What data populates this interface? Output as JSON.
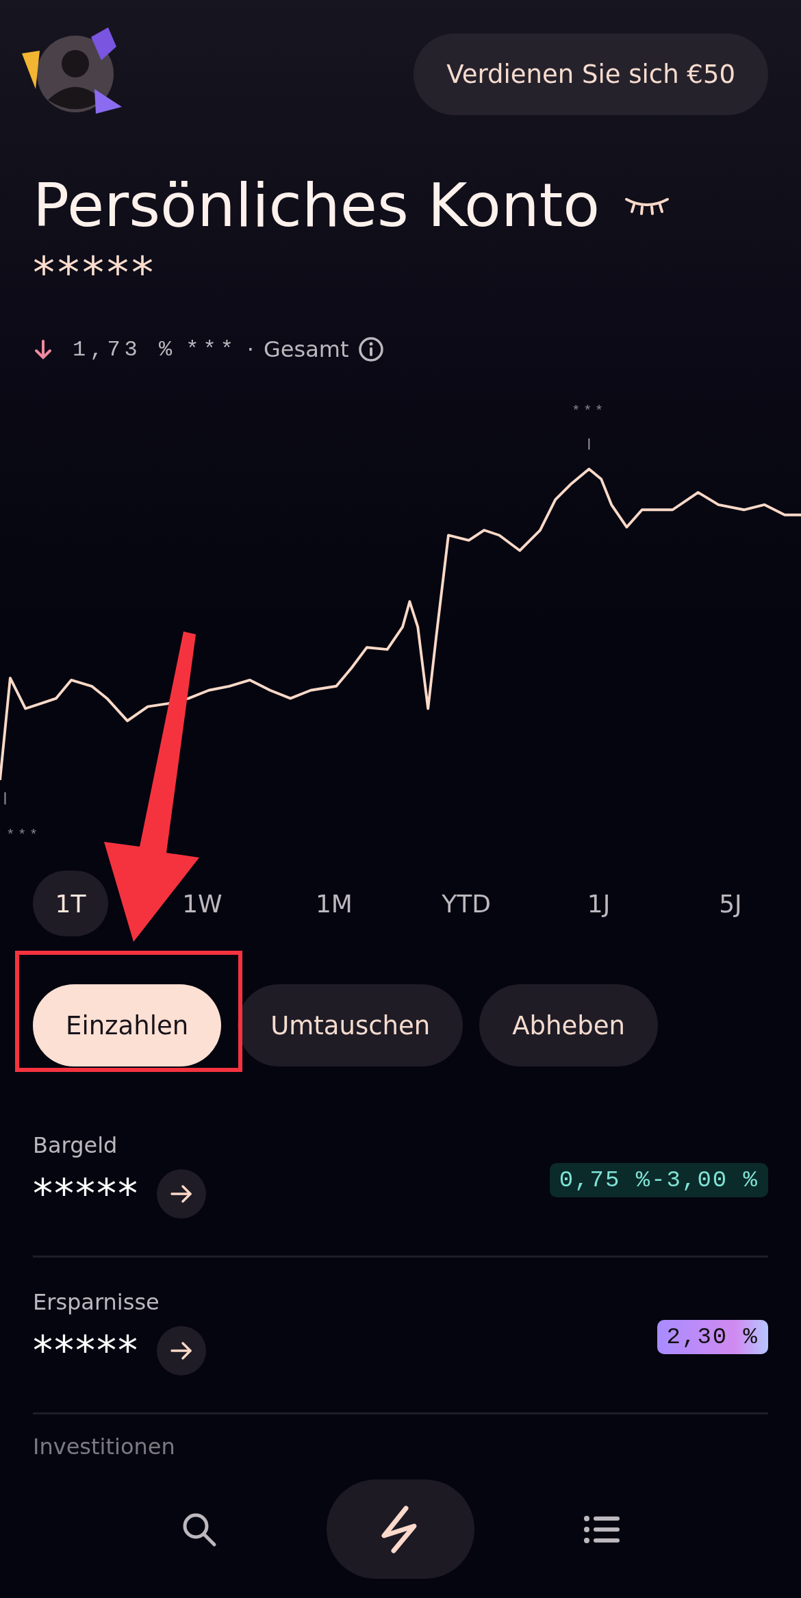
{
  "header": {
    "promo_button": "Verdienen Sie sich €50"
  },
  "account": {
    "title": "Persönliches Konto",
    "balance": "*****",
    "change": {
      "falling": true,
      "percent": "1,73 %",
      "amount": "***",
      "separator": "·",
      "period": "Gesamt"
    }
  },
  "chart": {
    "high_label": "***",
    "low_label": "***"
  },
  "periods": [
    {
      "label": "1T",
      "selected": true
    },
    {
      "label": "1W",
      "selected": false
    },
    {
      "label": "1M",
      "selected": false
    },
    {
      "label": "YTD",
      "selected": false
    },
    {
      "label": "1J",
      "selected": false
    },
    {
      "label": "5J",
      "selected": false
    }
  ],
  "actions": [
    {
      "label": "Einzahlen",
      "kind": "primary"
    },
    {
      "label": "Umtauschen",
      "kind": "secondary"
    },
    {
      "label": "Abheben",
      "kind": "secondary"
    }
  ],
  "accounts": [
    {
      "name": "Bargeld",
      "balance": "*****",
      "rate": "0,75 %-3,00 %",
      "kind": "teal"
    },
    {
      "name": "Ersparnisse",
      "balance": "*****",
      "rate": "2,30 %",
      "kind": "gradient"
    },
    {
      "name": "Investitionen",
      "kind": "faded"
    }
  ],
  "nav": [
    {
      "selected": false
    },
    {
      "selected": true
    },
    {
      "selected": false
    }
  ]
}
